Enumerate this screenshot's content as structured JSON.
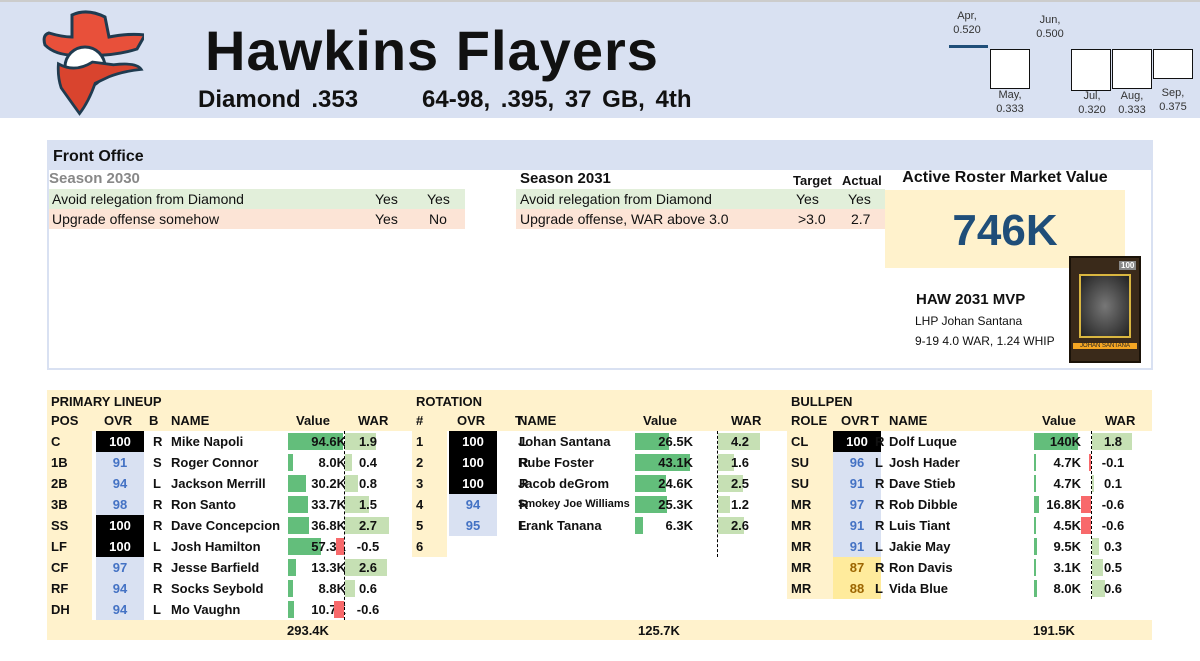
{
  "header": {
    "title": "Hawkins Flayers",
    "subtitle": "Diamond .353      64-98, .395, 37 GB, 4th",
    "logo": "cowboy-baseball-bandit-logo",
    "months": [
      {
        "label": "Apr,",
        "value": "0.520",
        "v": 0.52
      },
      {
        "label": "May,",
        "value": "0.333",
        "v": 0.333
      },
      {
        "label": "Jun,",
        "value": "0.500",
        "v": 0.5
      },
      {
        "label": "Jul,",
        "value": "0.320",
        "v": 0.32
      },
      {
        "label": "Aug,",
        "value": "0.333",
        "v": 0.333
      },
      {
        "label": "Sep,",
        "value": "0.375",
        "v": 0.375
      }
    ]
  },
  "front_office": {
    "title": "Front Office",
    "season_prev": {
      "label": "Season 2030",
      "rows": [
        {
          "goal": "Avoid relegation from Diamond",
          "target": "Yes",
          "actual": "Yes",
          "status": "met"
        },
        {
          "goal": "Upgrade offense somehow",
          "target": "Yes",
          "actual": "No",
          "status": "missed"
        }
      ]
    },
    "season_cur": {
      "label": "Season 2031",
      "target_header": "Target",
      "actual_header": "Actual",
      "rows": [
        {
          "goal": "Avoid relegation from Diamond",
          "target": "Yes",
          "actual": "Yes",
          "status": "met"
        },
        {
          "goal": "Upgrade offense, WAR above 3.0",
          "target": ">3.0",
          "actual": "2.7",
          "status": "missed"
        }
      ]
    },
    "market_value": {
      "label": "Active Roster Market Value",
      "value": "746K"
    },
    "mvp": {
      "title": "HAW 2031 MVP",
      "player": "LHP Johan Santana",
      "stats": "9-19 4.0 WAR, 1.24 WHIP",
      "card_name": "JOHAN SANTANA",
      "card_ovr": "100"
    }
  },
  "colors": {
    "value_bar": "#63BE7B",
    "war_pos": "#C6E0B4",
    "war_neg": "#F8696B",
    "ovr_elite": "#000000",
    "ovr_high": "#D9E1F2",
    "ovr_mid": "#FFEB9C"
  },
  "lineup": {
    "title": "PRIMARY LINEUP",
    "headers": [
      "POS",
      "OVR",
      "B",
      "NAME",
      "Value",
      "WAR"
    ],
    "total": "293.4K",
    "rows": [
      [
        "C",
        "100",
        "R",
        "Mike Napoli",
        "94.6K",
        "1.9"
      ],
      [
        "1B",
        "91",
        "S",
        "Roger Connor",
        "8.0K",
        "0.4"
      ],
      [
        "2B",
        "94",
        "L",
        "Jackson Merrill",
        "30.2K",
        "0.8"
      ],
      [
        "3B",
        "98",
        "R",
        "Ron Santo",
        "33.7K",
        "1.5"
      ],
      [
        "SS",
        "100",
        "R",
        "Dave Concepcion",
        "36.8K",
        "2.7"
      ],
      [
        "LF",
        "100",
        "L",
        "Josh Hamilton",
        "57.3K",
        "-0.5"
      ],
      [
        "CF",
        "97",
        "R",
        "Jesse Barfield",
        "13.3K",
        "2.6"
      ],
      [
        "RF",
        "94",
        "R",
        "Socks Seybold",
        "8.8K",
        "0.6"
      ],
      [
        "DH",
        "94",
        "L",
        "Mo Vaughn",
        "10.7K",
        "-0.6"
      ]
    ]
  },
  "rotation": {
    "title": "ROTATION",
    "headers": [
      "#",
      "OVR",
      "T",
      "NAME",
      "Value",
      "WAR"
    ],
    "total": "125.7K",
    "rows": [
      [
        "1",
        "100",
        "L",
        "Johan Santana",
        "26.5K",
        "4.2"
      ],
      [
        "2",
        "100",
        "R",
        "Rube Foster",
        "43.1K",
        "1.6"
      ],
      [
        "3",
        "100",
        "R",
        "Jacob deGrom",
        "24.6K",
        "2.5"
      ],
      [
        "4",
        "94",
        "R",
        "Smokey Joe Williams",
        "25.3K",
        "1.2"
      ],
      [
        "5",
        "95",
        "L",
        "Frank Tanana",
        "6.3K",
        "2.6"
      ],
      [
        "6",
        "",
        "",
        "",
        "",
        ""
      ]
    ]
  },
  "bullpen": {
    "title": "BULLPEN",
    "headers": [
      "ROLE",
      "OVR",
      "T",
      "NAME",
      "Value",
      "WAR"
    ],
    "total": "191.5K",
    "rows": [
      [
        "CL",
        "100",
        "R",
        "Dolf Luque",
        "140K",
        "1.8"
      ],
      [
        "SU",
        "96",
        "L",
        "Josh Hader",
        "4.7K",
        "-0.1"
      ],
      [
        "SU",
        "91",
        "R",
        "Dave Stieb",
        "4.7K",
        "0.1"
      ],
      [
        "MR",
        "97",
        "R",
        "Rob Dibble",
        "16.8K",
        "-0.6"
      ],
      [
        "MR",
        "91",
        "R",
        "Luis Tiant",
        "4.5K",
        "-0.6"
      ],
      [
        "MR",
        "91",
        "L",
        "Jakie May",
        "9.5K",
        "0.3"
      ],
      [
        "MR",
        "87",
        "R",
        "Ron Davis",
        "3.1K",
        "0.5"
      ],
      [
        "MR",
        "88",
        "L",
        "Vida Blue",
        "8.0K",
        "0.6"
      ]
    ]
  }
}
